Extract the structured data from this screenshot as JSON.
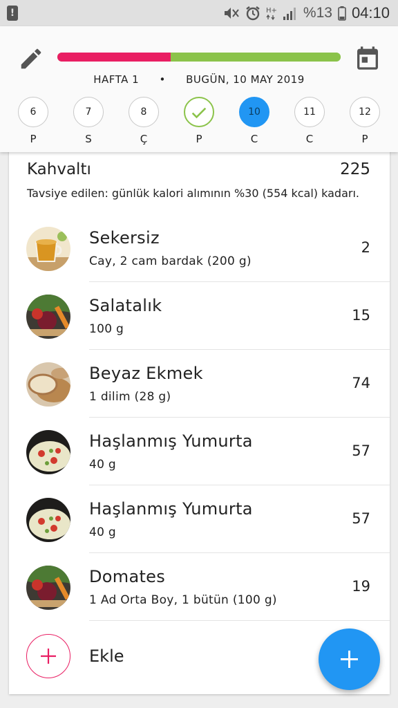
{
  "status_bar": {
    "battery_percent": "%13",
    "time": "04:10",
    "icons": [
      "alert-icon",
      "mute-icon",
      "alarm-icon",
      "hplus-icon",
      "signal-icon",
      "battery-icon"
    ]
  },
  "header": {
    "progress": {
      "consumed_fraction": 0.4
    },
    "colors": {
      "red": "#e91e63",
      "green": "#8bc34a",
      "accent": "#2196f3"
    },
    "week_label": "HAFTA 1",
    "separator": "•",
    "date_label": "BUGÜN, 10 MAY 2019",
    "days": [
      {
        "number": "6",
        "letter": "P"
      },
      {
        "number": "7",
        "letter": "S"
      },
      {
        "number": "8",
        "letter": "Ç"
      },
      {
        "number": "",
        "letter": "P",
        "state": "done"
      },
      {
        "number": "10",
        "letter": "C",
        "state": "today"
      },
      {
        "number": "11",
        "letter": "C"
      },
      {
        "number": "12",
        "letter": "P"
      }
    ]
  },
  "meal": {
    "title": "Kahvaltı",
    "total": "225",
    "recommendation": "Tavsiye edilen: günlük kalori alımının %30 (554 kcal) kadarı.",
    "items": [
      {
        "name": "Sekersiz",
        "portion": "Cay, 2 cam bardak (200 g)",
        "kcal": "2",
        "image": "tea"
      },
      {
        "name": "Salatalık",
        "portion": "100 g",
        "kcal": "15",
        "image": "vegetables"
      },
      {
        "name": "Beyaz Ekmek",
        "portion": "1 dilim (28 g)",
        "kcal": "74",
        "image": "bread"
      },
      {
        "name": "Haşlanmış Yumurta",
        "portion": "40 g",
        "kcal": "57",
        "image": "egg-dish"
      },
      {
        "name": "Haşlanmış Yumurta",
        "portion": "40 g",
        "kcal": "57",
        "image": "egg-dish"
      },
      {
        "name": "Domates",
        "portion": "1 Ad Orta Boy, 1 bütün (100 g)",
        "kcal": "19",
        "image": "vegetables"
      }
    ],
    "add_label": "Ekle"
  }
}
